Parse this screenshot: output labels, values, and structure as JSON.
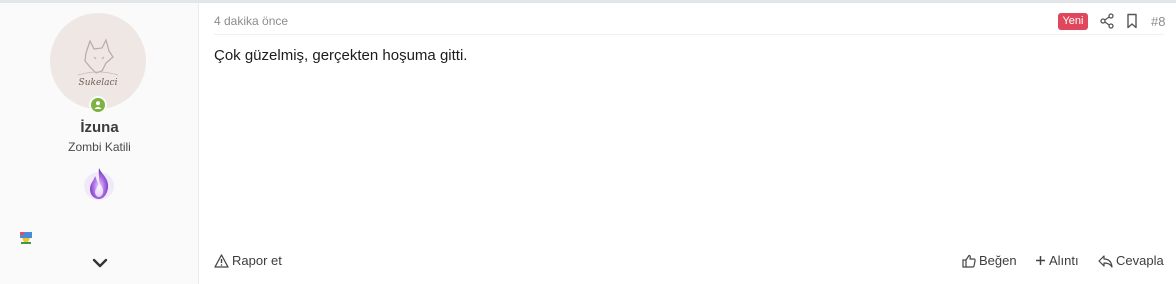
{
  "user": {
    "name": "İzuna",
    "title": "Zombi Katili",
    "avatar_text": "Sukelaci",
    "online_icon": "user-online-icon",
    "flame_badge_icon": "purple-flame-badge-icon",
    "small_badge_icon": "trophy-badge-icon",
    "expand_icon": "chevron-down-icon"
  },
  "post": {
    "timestamp": "4 dakika önce",
    "new_badge": "Yeni",
    "number": "#8",
    "message": "Çok güzelmiş, gerçekten hoşuma gitti."
  },
  "actions": {
    "report": "Rapor et",
    "like": "Beğen",
    "quote": "Alıntı",
    "reply": "Cevapla"
  },
  "colors": {
    "new_badge": "#e0475c",
    "online": "#7cb342",
    "sidebar_bg": "#fafafa"
  }
}
